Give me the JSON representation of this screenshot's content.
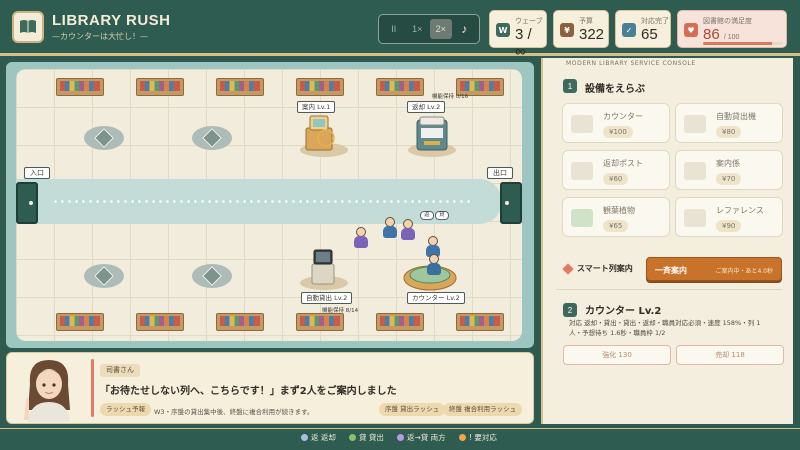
{
  "header": {
    "title": "LIBRARY RUSH",
    "subtitle": "—カウンターは大忙し！—"
  },
  "controls": {
    "pause_label": "II",
    "speed1_label": "1×",
    "speed2_label": "2×",
    "music_label": "♪",
    "active_speed": "2×"
  },
  "stats": {
    "wave": {
      "label": "ウェーブ",
      "value": "3 / ∞",
      "icon": "wave-icon"
    },
    "budget": {
      "label": "予算",
      "value": "322",
      "icon": "yen-icon"
    },
    "served": {
      "label": "対応完了",
      "value": "65",
      "icon": "check-icon"
    },
    "satisfaction": {
      "label": "図書館の満足度",
      "value": "86",
      "max": "/ 100",
      "fill_percent": 86,
      "icon": "heart-icon"
    }
  },
  "game": {
    "entrance_label": "入口",
    "exit_label": "出口",
    "stations": {
      "guide": "案内 Lv.1",
      "return": "返却 Lv.2",
      "self_checkout": "自動貸出 Lv.2",
      "counter": "カウンター Lv.2"
    },
    "captions": {
      "return_capacity": "機能保持 0/16",
      "self_checkout_capacity": "機能保持 8/14"
    },
    "bubbles": [
      "返",
      "貸"
    ]
  },
  "dialogue": {
    "speaker": "司書さん",
    "text": "「お待たせしない列へ、こちらです！」まず2人をご案内しました",
    "tag_left": "ラッシュ予報",
    "note": "W3・序盤の貸出集中後、終盤に複合利用が続きます。",
    "tag_right1": "序盤 貸出ラッシュ",
    "tag_right2": "終盤 複合利用ラッシュ"
  },
  "panel": {
    "title": "MODERN LIBRARY SERVICE CONSOLE",
    "section1": {
      "step": "1",
      "heading": "設備をえらぶ"
    },
    "cards": [
      {
        "name": "カウンター",
        "price": "¥100",
        "icon": "counter-icon"
      },
      {
        "name": "自動貸出機",
        "price": "¥80",
        "icon": "kiosk-icon"
      },
      {
        "name": "返却ポスト",
        "price": "¥60",
        "icon": "return-post-icon"
      },
      {
        "name": "案内係",
        "price": "¥70",
        "icon": "guide-icon"
      },
      {
        "name": "観葉植物",
        "price": "¥65",
        "icon": "plant-icon"
      },
      {
        "name": "レファレンス",
        "price": "¥90",
        "icon": "reference-icon"
      }
    ],
    "smart": {
      "label": "スマート列案内",
      "button": "一斉案内",
      "status": "ご案内中・あと4.0秒"
    },
    "section2": {
      "step": "2",
      "heading": "カウンター Lv.2",
      "line1": "対応 返却・貸出・貸出・返却・職員対応必須・速度 158%・列 1",
      "line2": "人・予想待ち 1.6秒・職員枠 1/2"
    },
    "upgrade_label": "強化 130",
    "sell_label": "売却 118"
  },
  "legend": [
    {
      "label": "返 返却",
      "color": "#a9c0e4"
    },
    {
      "label": "貸 貸出",
      "color": "#8cc26e"
    },
    {
      "label": "返→貸 両方",
      "color": "#b79ce2"
    },
    {
      "label": "! 要対応",
      "color": "#f0a64a"
    }
  ],
  "colors": {
    "brand": "#2f5c50",
    "accent": "#c9722a",
    "gold": "#d6c089",
    "heart": "#d56e55"
  }
}
